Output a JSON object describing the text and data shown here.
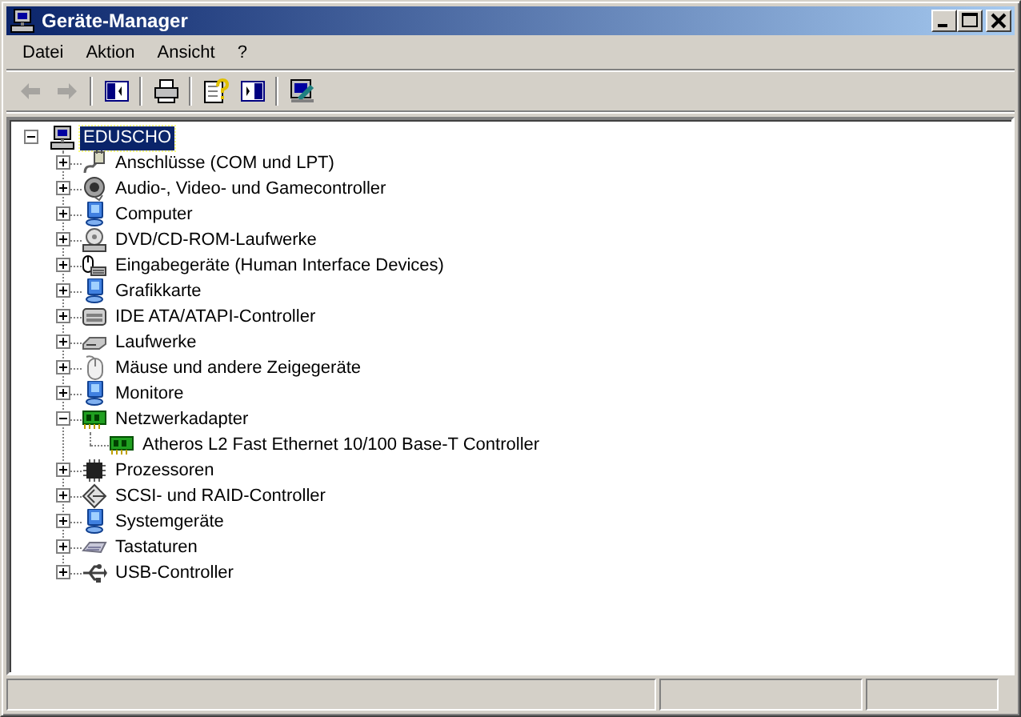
{
  "window": {
    "title": "Geräte-Manager"
  },
  "menu": [
    "Datei",
    "Aktion",
    "Ansicht",
    "?"
  ],
  "toolbar": [
    {
      "kind": "back",
      "disabled": true
    },
    {
      "kind": "forward",
      "disabled": true
    },
    {
      "kind": "separator"
    },
    {
      "kind": "tree-toggle",
      "disabled": false
    },
    {
      "kind": "separator"
    },
    {
      "kind": "print",
      "disabled": false
    },
    {
      "kind": "separator"
    },
    {
      "kind": "properties",
      "disabled": false
    },
    {
      "kind": "panel",
      "disabled": false
    },
    {
      "kind": "separator"
    },
    {
      "kind": "scan",
      "disabled": false
    }
  ],
  "tree": {
    "label": "EDUSCHO",
    "kind": "computer",
    "selected": true,
    "expanded": true,
    "children": [
      {
        "label": "Anschlüsse (COM und LPT)",
        "kind": "port",
        "expanded": false,
        "selected": false
      },
      {
        "label": "Audio-, Video- und Gamecontroller",
        "kind": "audio",
        "expanded": false,
        "selected": false
      },
      {
        "label": "Computer",
        "kind": "pc",
        "expanded": false,
        "selected": false
      },
      {
        "label": "DVD/CD-ROM-Laufwerke",
        "kind": "cdrom",
        "expanded": false,
        "selected": false
      },
      {
        "label": "Eingabegeräte (Human Interface Devices)",
        "kind": "hid",
        "expanded": false,
        "selected": false
      },
      {
        "label": "Grafikkarte",
        "kind": "pc",
        "expanded": false,
        "selected": false
      },
      {
        "label": "IDE ATA/ATAPI-Controller",
        "kind": "ide",
        "expanded": false,
        "selected": false
      },
      {
        "label": "Laufwerke",
        "kind": "disk",
        "expanded": false,
        "selected": false
      },
      {
        "label": "Mäuse und andere Zeigegeräte",
        "kind": "mouse",
        "expanded": false,
        "selected": false
      },
      {
        "label": "Monitore",
        "kind": "pc",
        "expanded": false,
        "selected": false
      },
      {
        "label": "Netzwerkadapter",
        "kind": "network",
        "expanded": true,
        "selected": false,
        "children": [
          {
            "label": "Atheros L2 Fast Ethernet 10/100 Base-T Controller",
            "kind": "network",
            "selected": false
          }
        ]
      },
      {
        "label": "Prozessoren",
        "kind": "cpu",
        "expanded": false,
        "selected": false
      },
      {
        "label": "SCSI- und RAID-Controller",
        "kind": "scsi",
        "expanded": false,
        "selected": false
      },
      {
        "label": "Systemgeräte",
        "kind": "pc",
        "expanded": false,
        "selected": false
      },
      {
        "label": "Tastaturen",
        "kind": "keyboard",
        "expanded": false,
        "selected": false
      },
      {
        "label": "USB-Controller",
        "kind": "usb",
        "expanded": false,
        "selected": false
      }
    ]
  }
}
